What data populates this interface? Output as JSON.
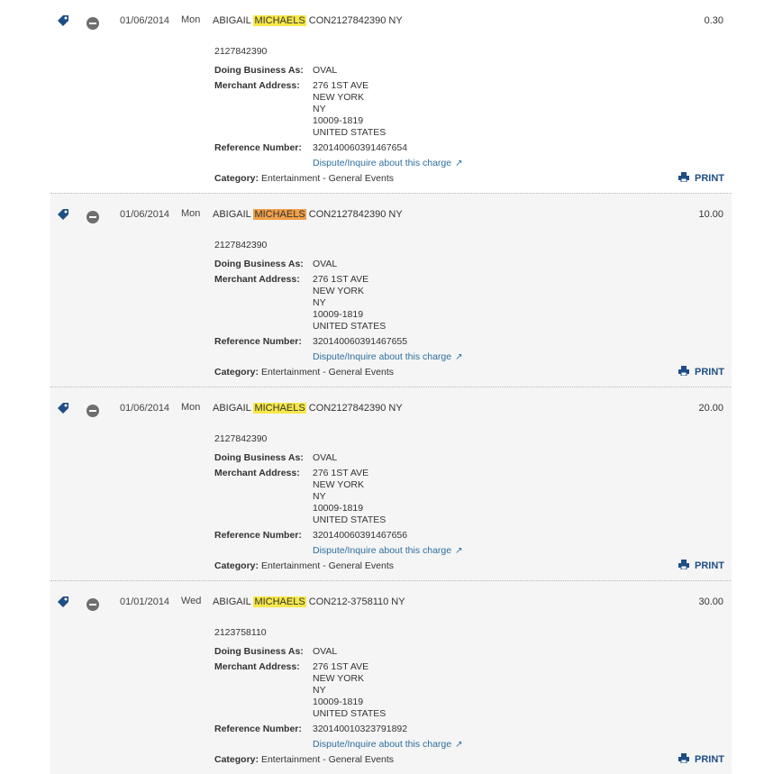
{
  "labels": {
    "dba": "Doing Business As:",
    "merchant_address": "Merchant Address:",
    "reference_number": "Reference Number:",
    "category": "Category:",
    "dispute": "Dispute/Inquire about this charge",
    "print": "PRINT"
  },
  "colors": {
    "highlight_yellow": "#f6e84a",
    "highlight_orange": "#f0a049",
    "link_blue": "#2d6f9e",
    "print_blue": "#1f4e86"
  },
  "transactions": [
    {
      "date": "01/06/2014",
      "dow": "Mon",
      "desc_before": "ABIGAIL ",
      "desc_highlight": "MICHAELS",
      "desc_after": " CON2127842390 NY",
      "amount": "0.30",
      "phone": "2127842390",
      "dba": "OVAL",
      "address": [
        "276 1ST AVE",
        "NEW YORK",
        "NY",
        "10009-1819",
        "UNITED STATES"
      ],
      "reference": "320140060391467654",
      "category": "Entertainment - General Events"
    },
    {
      "date": "01/06/2014",
      "dow": "Mon",
      "desc_before": "ABIGAIL ",
      "desc_highlight": "MICHAELS",
      "desc_after": " CON2127842390 NY",
      "amount": "10.00",
      "phone": "2127842390",
      "dba": "OVAL",
      "address": [
        "276 1ST AVE",
        "NEW YORK",
        "NY",
        "10009-1819",
        "UNITED STATES"
      ],
      "reference": "320140060391467655",
      "category": "Entertainment - General Events"
    },
    {
      "date": "01/06/2014",
      "dow": "Mon",
      "desc_before": "ABIGAIL ",
      "desc_highlight": "MICHAELS",
      "desc_after": " CON2127842390 NY",
      "amount": "20.00",
      "phone": "2127842390",
      "dba": "OVAL",
      "address": [
        "276 1ST AVE",
        "NEW YORK",
        "NY",
        "10009-1819",
        "UNITED STATES"
      ],
      "reference": "320140060391467656",
      "category": "Entertainment - General Events"
    },
    {
      "date": "01/01/2014",
      "dow": "Wed",
      "desc_before": "ABIGAIL ",
      "desc_highlight": "MICHAELS",
      "desc_after": " CON212-3758110 NY",
      "amount": "30.00",
      "phone": "2123758110",
      "dba": "OVAL",
      "address": [
        "276 1ST AVE",
        "NEW YORK",
        "NY",
        "10009-1819",
        "UNITED STATES"
      ],
      "reference": "320140010323791892",
      "category": "Entertainment - General Events"
    }
  ]
}
